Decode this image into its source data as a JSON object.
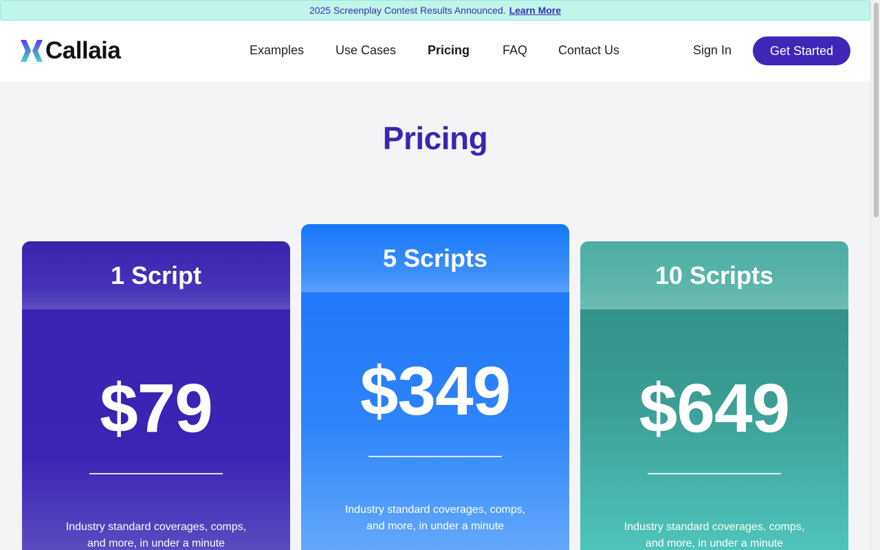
{
  "banner": {
    "text": "2025 Screenplay Contest Results Announced.",
    "link": "Learn More"
  },
  "brand": {
    "name": "Callaia"
  },
  "nav": {
    "items": [
      {
        "label": "Examples",
        "active": false
      },
      {
        "label": "Use Cases",
        "active": false
      },
      {
        "label": "Pricing",
        "active": true
      },
      {
        "label": "FAQ",
        "active": false
      },
      {
        "label": "Contact Us",
        "active": false
      }
    ],
    "sign_in": "Sign In",
    "get_started": "Get Started"
  },
  "page": {
    "title": "Pricing"
  },
  "plans": [
    {
      "name": "1 Script",
      "price": "$79",
      "description": "Industry standard coverages, comps, and more, in under a minute"
    },
    {
      "name": "5 Scripts",
      "price": "$349",
      "description": "Industry standard coverages, comps, and more, in under a minute"
    },
    {
      "name": "10 Scripts",
      "price": "$649",
      "description": "Industry standard coverages, comps, and more, in under a minute"
    }
  ],
  "colors": {
    "accent": "#3f26b8",
    "banner_bg": "#bff5ea",
    "plan_1": "#3b22b0",
    "plan_2": "#1b73f8",
    "plan_3": "#3a9c93"
  }
}
